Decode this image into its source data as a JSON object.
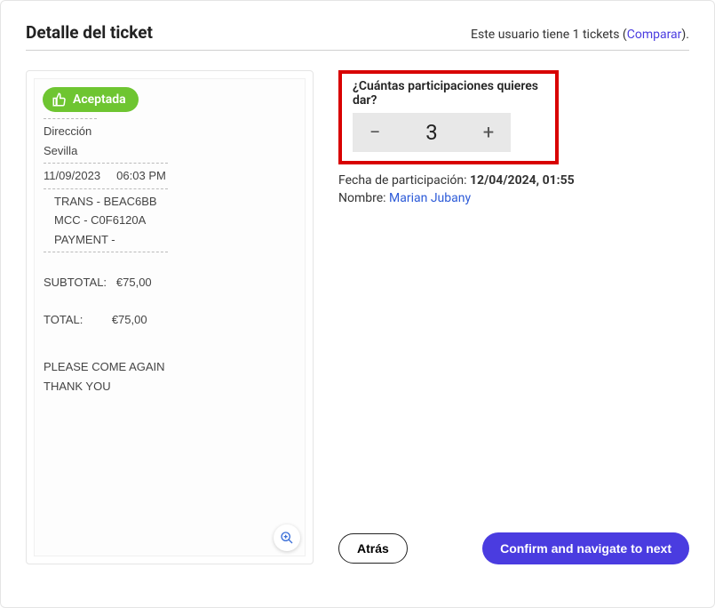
{
  "header": {
    "title": "Detalle del ticket",
    "right_prefix": "Este usuario tiene ",
    "right_count": "1",
    "right_suffix": " tickets (",
    "compare_label": "Comparar",
    "right_end": ")."
  },
  "badge": {
    "label": "Aceptada"
  },
  "receipt": {
    "direccion_label": "Dirección",
    "city": "Sevilla",
    "date": "11/09/2023",
    "time": "06:03 PM",
    "trans": "TRANS - BEAC6BB",
    "mcc": "MCC - C0F6120A",
    "payment": "PAYMENT -",
    "subtotal_label": "SUBTOTAL:",
    "subtotal_value": "€75,00",
    "total_label": "TOTAL:",
    "total_value": "€75,00",
    "footer1": "PLEASE COME AGAIN",
    "footer2": "THANK YOU"
  },
  "question": {
    "label": "¿Cuántas participaciones quieres dar?",
    "value": "3"
  },
  "meta": {
    "fecha_label": "Fecha de participación: ",
    "fecha_value": "12/04/2024, 01:55",
    "nombre_label": "Nombre: ",
    "nombre_value": "Marian Jubany"
  },
  "actions": {
    "back": "Atrás",
    "confirm": "Confirm and navigate to next"
  }
}
